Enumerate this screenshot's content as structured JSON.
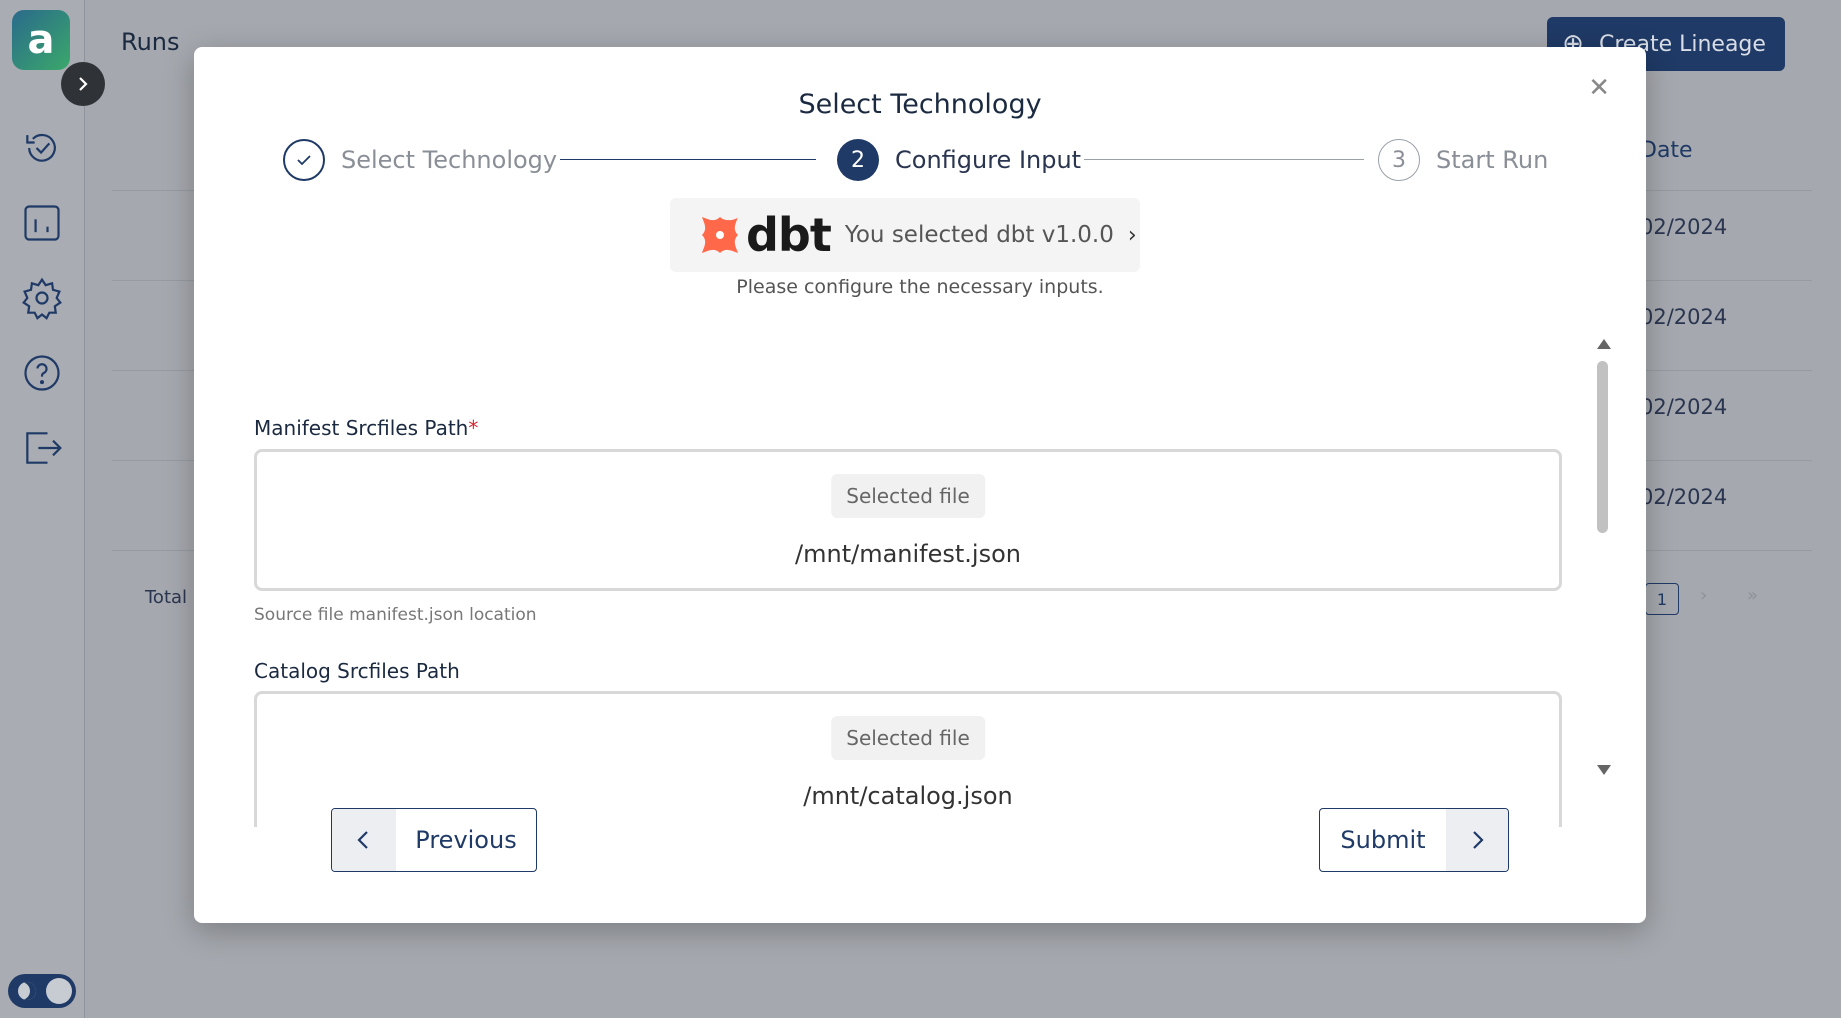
{
  "background": {
    "page_title": "Runs",
    "create_button_label": "Create Lineage",
    "date_column_header": "Date",
    "row_dates": [
      "02/2024",
      "02/2024",
      "02/2024",
      "02/2024"
    ],
    "total_label": "Total l",
    "pager_current": "1"
  },
  "modal": {
    "title": "Select Technology",
    "steps": [
      {
        "number": "",
        "label": "Select Technology",
        "state": "done"
      },
      {
        "number": "2",
        "label": "Configure Input",
        "state": "active"
      },
      {
        "number": "3",
        "label": "Start Run",
        "state": "todo"
      }
    ],
    "technology": {
      "logo_text": "dbt",
      "selected_text": "You selected dbt v1.0.0"
    },
    "hint": "Please configure the necessary inputs.",
    "fields": [
      {
        "label": "Manifest Srcfiles Path",
        "required_mark": "*",
        "chip": "Selected file",
        "path": "/mnt/manifest.json",
        "help": "Source file manifest.json location"
      },
      {
        "label": "Catalog Srcfiles Path",
        "chip": "Selected file",
        "path": "/mnt/catalog.json"
      }
    ],
    "previous_label": "Previous",
    "submit_label": "Submit"
  },
  "colors": {
    "primary": "#1f3a66",
    "required": "#d9262e",
    "dbt_orange": "#ff694a"
  }
}
